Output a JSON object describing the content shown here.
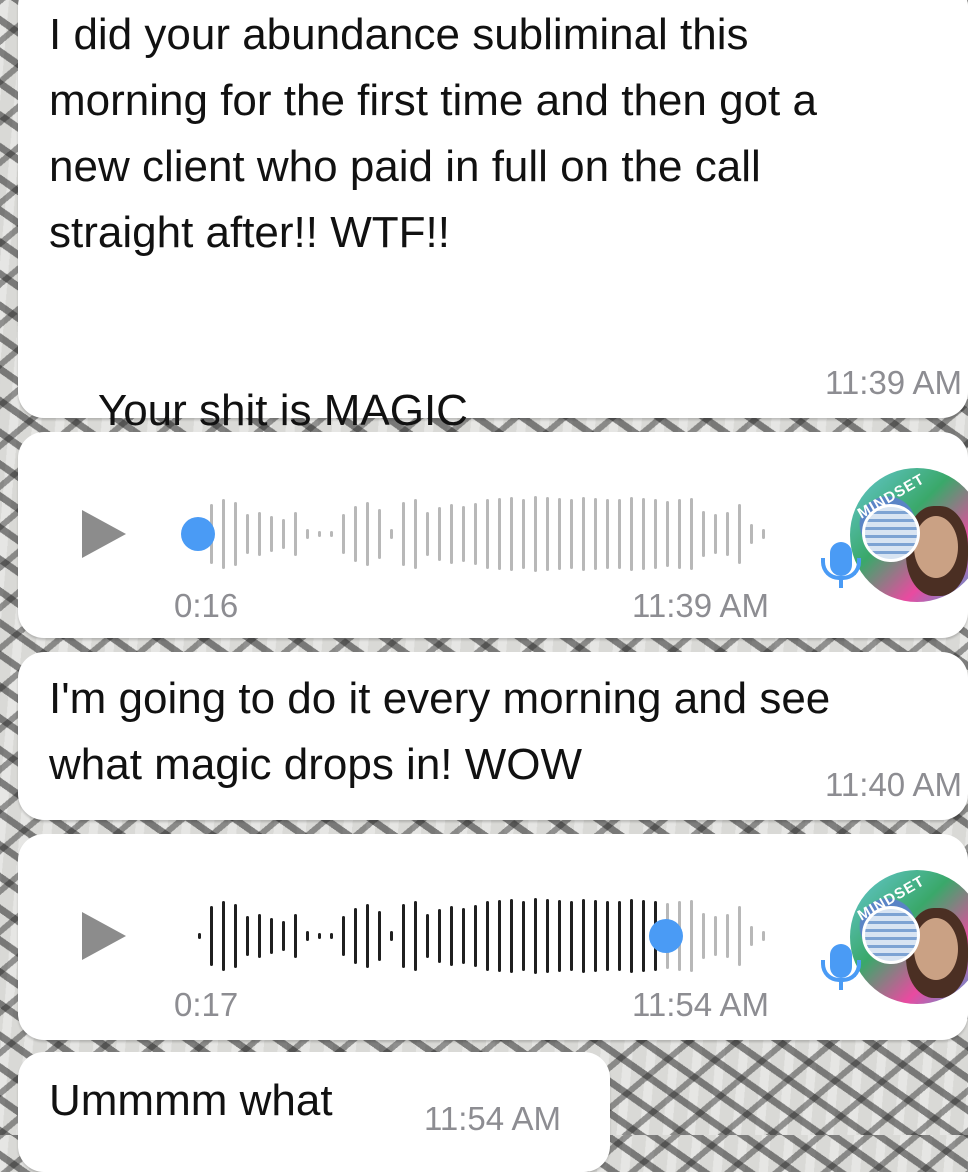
{
  "messages": {
    "m1": {
      "text": "I did your abundance subliminal this\nmorning for the first time and then got a\nnew client who paid in full on the call\nstraight after!! WTF!!",
      "text2": "Your shit is MAGIC",
      "emojis": {
        "exploding_head": "🤯",
        "heart": "❤️",
        "sparkles": "✨"
      },
      "time": "11:39 AM"
    },
    "v1": {
      "duration": "0:16",
      "time": "11:39 AM",
      "progress": 0.0,
      "icons": [
        "play-icon",
        "mic-icon",
        "avatar"
      ]
    },
    "m2": {
      "text": "I'm going to do it every morning and see\nwhat magic drops in! WOW",
      "time": "11:40 AM"
    },
    "v2": {
      "duration": "0:17",
      "time": "11:54 AM",
      "progress": 0.82,
      "icons": [
        "play-icon",
        "mic-icon",
        "avatar"
      ]
    },
    "m3": {
      "text": "Ummmm what",
      "time": "11:54 AM"
    }
  },
  "colors": {
    "bubble": "#ffffff",
    "timestamp": "#8d8d92",
    "accent_blue": "#4a9bf5",
    "wave_played": "#1f1f1f",
    "wave_unplayed": "#b8b8b8"
  }
}
